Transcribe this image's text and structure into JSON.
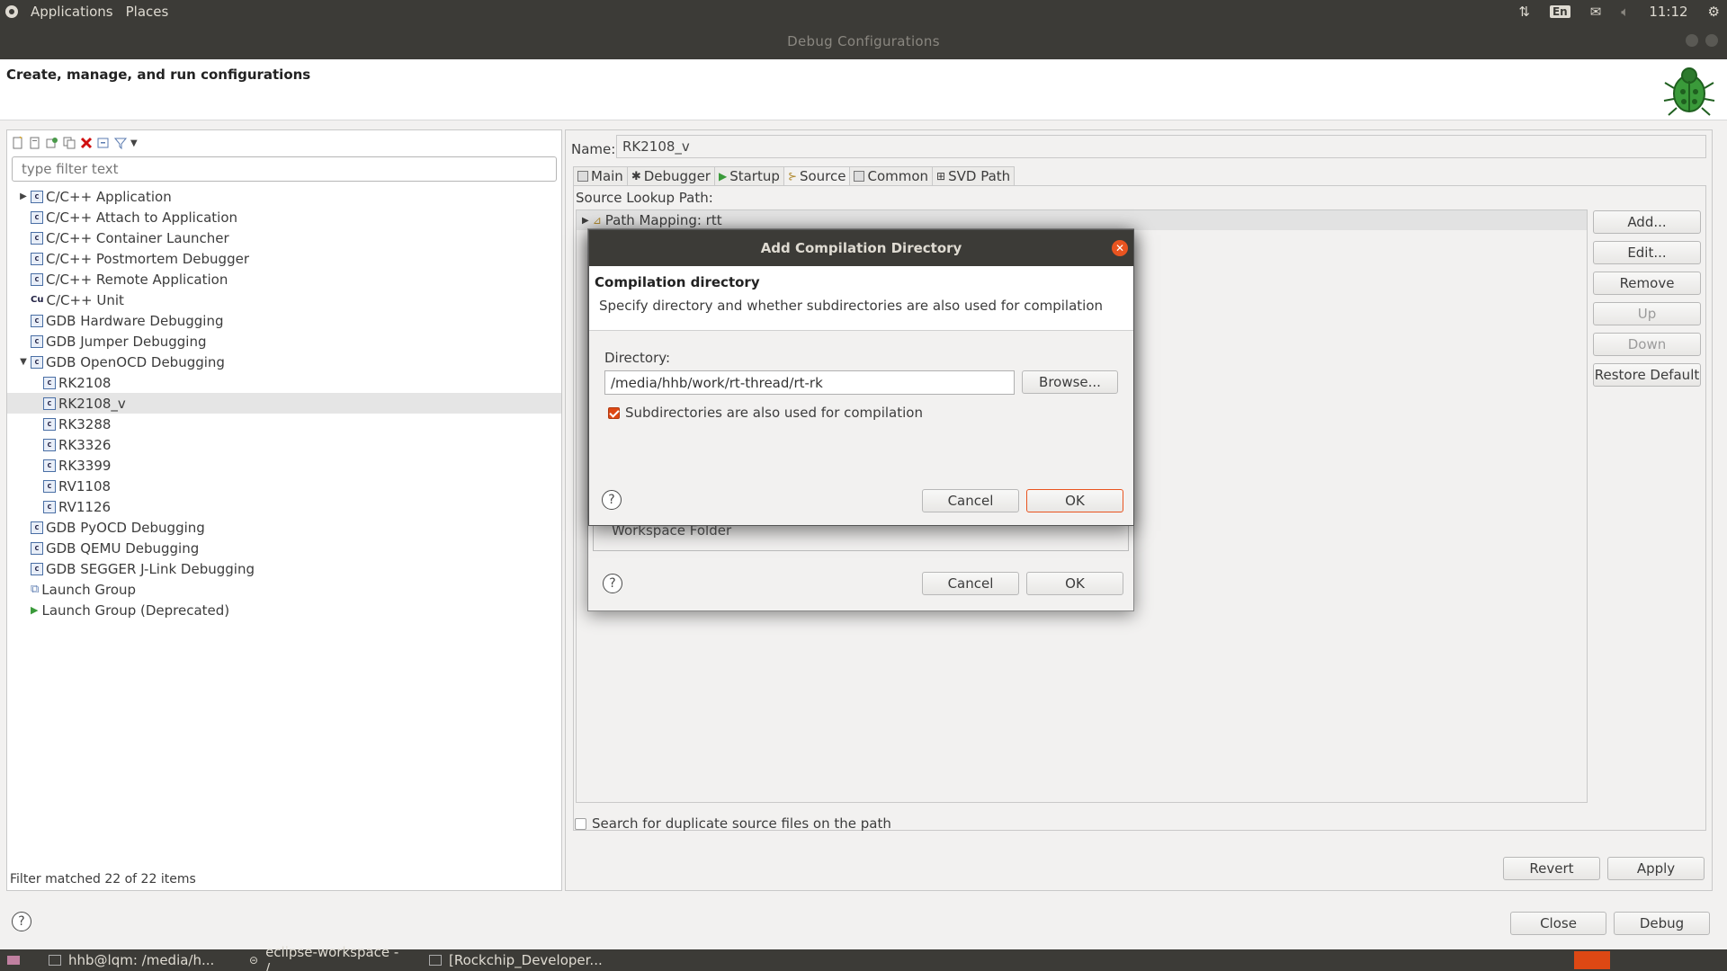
{
  "top_panel": {
    "menus": [
      "Applications",
      "Places"
    ],
    "tray_lang": "En",
    "time": "11:12"
  },
  "window": {
    "title": "Debug Configurations"
  },
  "header": {
    "title": "Create, manage, and run configurations"
  },
  "left": {
    "filter_placeholder": "type filter text",
    "tree": [
      {
        "label": "C/C++ Application",
        "level": 0,
        "twisty": "collapsed",
        "icon": "c"
      },
      {
        "label": "C/C++ Attach to Application",
        "level": 0,
        "twisty": "none",
        "icon": "c"
      },
      {
        "label": "C/C++ Container Launcher",
        "level": 0,
        "twisty": "none",
        "icon": "c"
      },
      {
        "label": "C/C++ Postmortem Debugger",
        "level": 0,
        "twisty": "none",
        "icon": "c"
      },
      {
        "label": "C/C++ Remote Application",
        "level": 0,
        "twisty": "none",
        "icon": "c"
      },
      {
        "label": "C/C++ Unit",
        "level": 0,
        "twisty": "none",
        "icon": "cu"
      },
      {
        "label": "GDB Hardware Debugging",
        "level": 0,
        "twisty": "none",
        "icon": "c"
      },
      {
        "label": "GDB Jumper Debugging",
        "level": 0,
        "twisty": "none",
        "icon": "c"
      },
      {
        "label": "GDB OpenOCD Debugging",
        "level": 0,
        "twisty": "expanded",
        "icon": "c"
      },
      {
        "label": "RK2108",
        "level": 1,
        "twisty": "none",
        "icon": "c"
      },
      {
        "label": "RK2108_v",
        "level": 1,
        "twisty": "none",
        "icon": "c",
        "selected": true
      },
      {
        "label": "RK3288",
        "level": 1,
        "twisty": "none",
        "icon": "c"
      },
      {
        "label": "RK3326",
        "level": 1,
        "twisty": "none",
        "icon": "c"
      },
      {
        "label": "RK3399",
        "level": 1,
        "twisty": "none",
        "icon": "c"
      },
      {
        "label": "RV1108",
        "level": 1,
        "twisty": "none",
        "icon": "c"
      },
      {
        "label": "RV1126",
        "level": 1,
        "twisty": "none",
        "icon": "c"
      },
      {
        "label": "GDB PyOCD Debugging",
        "level": 0,
        "twisty": "none",
        "icon": "c"
      },
      {
        "label": "GDB QEMU Debugging",
        "level": 0,
        "twisty": "none",
        "icon": "c"
      },
      {
        "label": "GDB SEGGER J-Link Debugging",
        "level": 0,
        "twisty": "none",
        "icon": "c"
      },
      {
        "label": "Launch Group",
        "level": 0,
        "twisty": "none",
        "icon": "group"
      },
      {
        "label": "Launch Group (Deprecated)",
        "level": 0,
        "twisty": "none",
        "icon": "play"
      }
    ],
    "status": "Filter matched 22 of 22 items"
  },
  "right": {
    "name_label": "Name:",
    "name_value": "RK2108_v",
    "tabs": [
      "Main",
      "Debugger",
      "Startup",
      "Source",
      "Common",
      "SVD Path"
    ],
    "active_tab": "Source",
    "source_lookup_label": "Source Lookup Path:",
    "path_mapping": "Path Mapping: rtt",
    "side_buttons": [
      {
        "label": "Add...",
        "enabled": true
      },
      {
        "label": "Edit...",
        "enabled": true
      },
      {
        "label": "Remove",
        "enabled": true
      },
      {
        "label": "Up",
        "enabled": false
      },
      {
        "label": "Down",
        "enabled": false
      },
      {
        "label": "Restore Default",
        "enabled": true
      }
    ],
    "duplicate_label": "Search for duplicate source files on the path",
    "revert": "Revert",
    "apply": "Apply"
  },
  "footer": {
    "close": "Close",
    "debug": "Debug"
  },
  "back_dialog": {
    "workspace_folder": "Workspace Folder",
    "cancel": "Cancel",
    "ok": "OK"
  },
  "dialog": {
    "title": "Add Compilation Directory",
    "heading": "Compilation directory",
    "description": "Specify directory and whether subdirectories are also used for compilation",
    "directory_label": "Directory:",
    "directory_value": "/media/hhb/work/rt-thread/rt-rk",
    "browse": "Browse...",
    "subdirs_label": "Subdirectories are also used for compilation",
    "subdirs_checked": true,
    "cancel": "Cancel",
    "ok": "OK"
  },
  "taskbar": {
    "items": [
      "hhb@lqm: /media/h...",
      "eclipse-workspace - /...",
      "[Rockchip_Developer..."
    ]
  },
  "colors": {
    "accent": "#e95420",
    "panel": "#3c3b37"
  }
}
